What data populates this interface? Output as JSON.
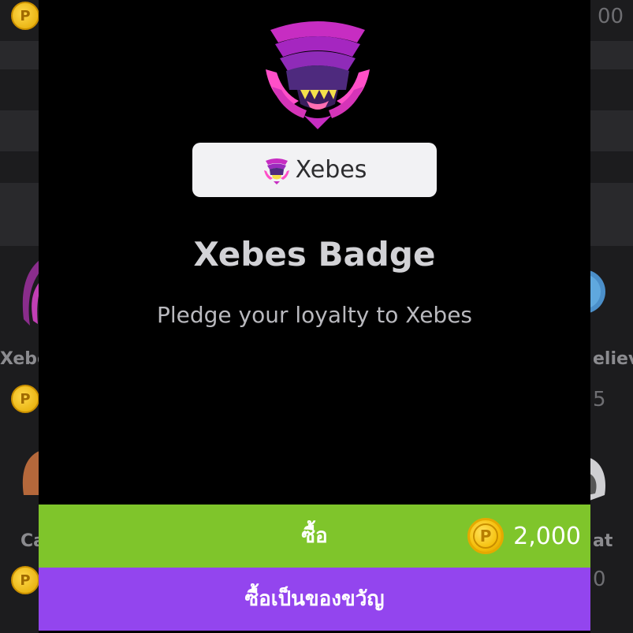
{
  "background": {
    "top_right_num": "00",
    "left_name_1": "Xebe",
    "right_name_1": "elieve",
    "right_num_1": "5",
    "left_name_2": "Ca",
    "right_name_2": "at",
    "right_num_2": "0"
  },
  "modal": {
    "badge_name": "Xebes",
    "title": "Xebes Badge",
    "description": "Pledge your loyalty to Xebes",
    "buy_label": "ซื้อ",
    "currency_symbol": "P",
    "price": "2,000",
    "gift_label": "ซื้อเป็นของขวัญ"
  },
  "colors": {
    "buy_button": "#7fc52b",
    "gift_button": "#9345ee",
    "modal_background": "#000000"
  },
  "icons": {
    "badge_art": "xebes-creature-icon",
    "coin": "coin-icon"
  }
}
